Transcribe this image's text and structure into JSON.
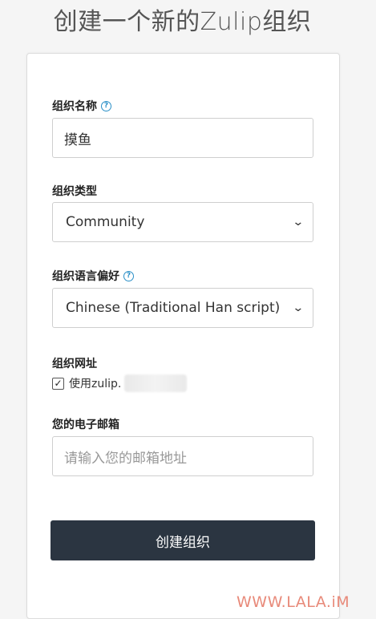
{
  "title": "创建一个新的Zulip组织",
  "org_name": {
    "label": "组织名称",
    "value": "摸鱼"
  },
  "org_type": {
    "label": "组织类型",
    "selected": "Community"
  },
  "org_language": {
    "label": "组织语言偏好",
    "selected": "Chinese (Traditional Han script)"
  },
  "org_url": {
    "label": "组织网址",
    "checkbox_label": "使用zulip.",
    "checked": true
  },
  "email": {
    "label": "您的电子邮箱",
    "placeholder": "请输入您的邮箱地址"
  },
  "submit_label": "创建组织",
  "watermark": "WWW.LALA.iM",
  "icons": {
    "help": "question-circle-icon",
    "check": "check-icon",
    "chevron": "chevron-down-icon"
  },
  "colors": {
    "accent": "#2a8fc7",
    "button": "#2b3541",
    "watermark": "#e88a7a"
  }
}
